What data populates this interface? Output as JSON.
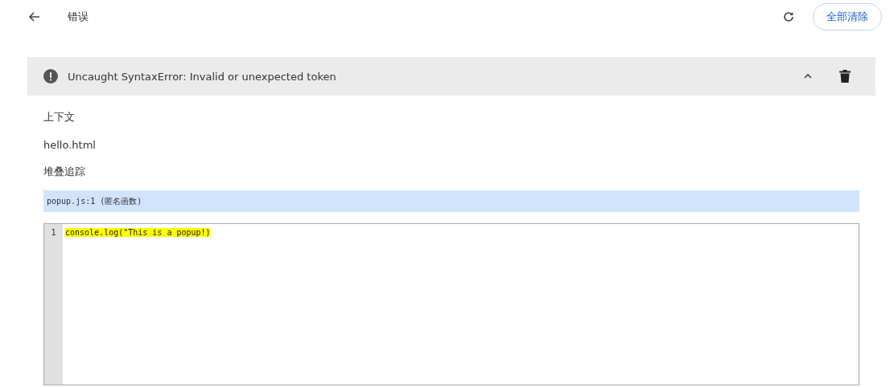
{
  "header": {
    "title": "错误",
    "clear_all_button": "全部清除"
  },
  "errors": [
    {
      "message": "Uncaught SyntaxError: Invalid or unexpected token",
      "expanded": true,
      "context_label": "上下文",
      "context": "hello.html",
      "stack_label": "堆叠追踪",
      "stack": [
        {
          "text": "popup.js:1 (匿名函数)",
          "selected": true
        }
      ],
      "code": [
        {
          "number": "1",
          "text": "console.log(\"This is a popup!)",
          "highlighted": true
        }
      ]
    }
  ]
}
